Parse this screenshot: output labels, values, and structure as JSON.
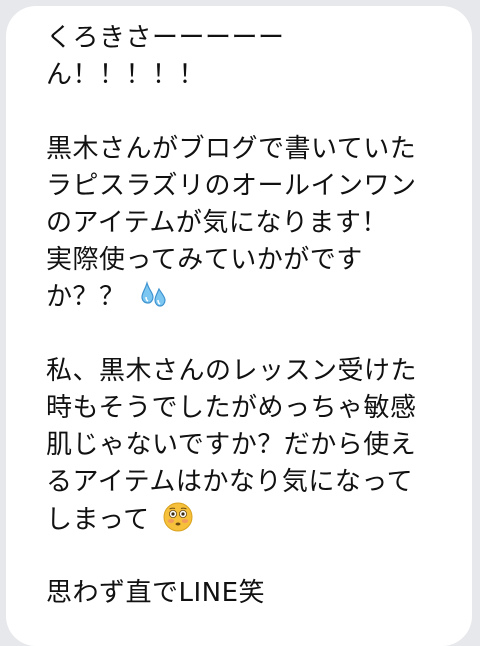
{
  "message": {
    "lines": [
      "くろきさーーーーー",
      "ん！！！！！",
      "",
      "黒木さんがブログで書いていた",
      "ラピスラズリのオールインワン",
      "のアイテムが気になります！",
      "実際使ってみていかがです",
      "か？？",
      "",
      "私、黒木さんのレッスン受けた",
      "時もそうでしたがめっちゃ敏感",
      "肌じゃないですか？だから使え",
      "るアイテムはかなり気になって",
      "しまって",
      "",
      "思わず直でLINE笑"
    ],
    "emojis": {
      "sweat_drops": "sweat-droplets-emoji",
      "flushed_face": "flushed-face-emoji"
    }
  }
}
